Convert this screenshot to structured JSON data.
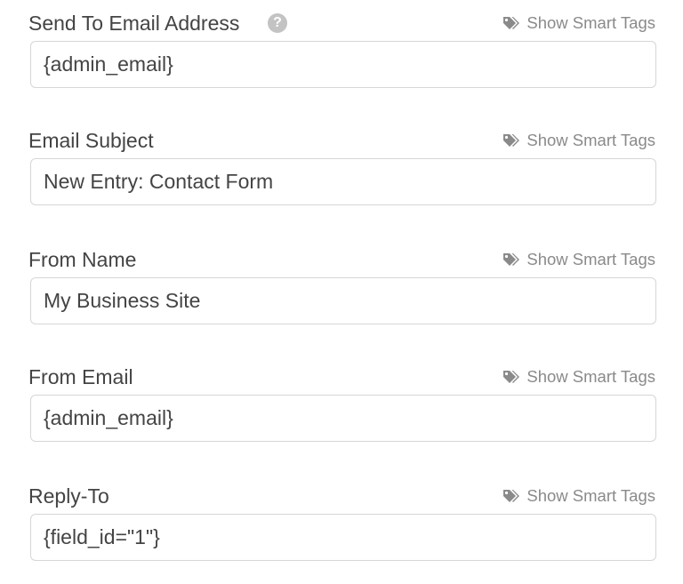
{
  "fields": [
    {
      "label": "Send To Email Address",
      "has_help": true,
      "help_glyph": "?",
      "smart_tags_label": "Show Smart Tags",
      "value": "{admin_email}"
    },
    {
      "label": "Email Subject",
      "has_help": false,
      "smart_tags_label": "Show Smart Tags",
      "value": "New Entry: Contact Form"
    },
    {
      "label": "From Name",
      "has_help": false,
      "smart_tags_label": "Show Smart Tags",
      "value": "My Business Site"
    },
    {
      "label": "From Email",
      "has_help": false,
      "smart_tags_label": "Show Smart Tags",
      "value": "{admin_email}"
    },
    {
      "label": "Reply-To",
      "has_help": false,
      "smart_tags_label": "Show Smart Tags",
      "value": "{field_id=\"1\"}"
    }
  ],
  "icons": {
    "help": "question-circle-icon",
    "smart_tags": "tags-icon"
  },
  "colors": {
    "label": "#444444",
    "muted": "#8a8a8a",
    "help_icon": "#c3c3c3",
    "input_border": "#d6d6d6"
  }
}
